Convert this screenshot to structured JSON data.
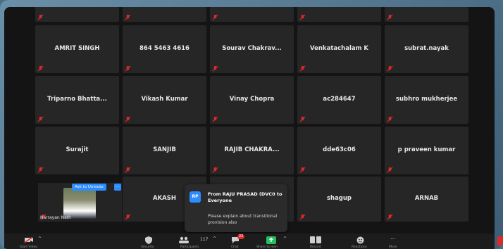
{
  "tiles": [
    {
      "name": "",
      "row": 0
    },
    {
      "name": "AMRIT SINGH",
      "row": 1,
      "col": 0
    },
    {
      "name": "864 5463 4616",
      "row": 1,
      "col": 1
    },
    {
      "name": "Sourav  Chakrav...",
      "row": 1,
      "col": 2
    },
    {
      "name": "Venkatachalam K",
      "row": 1,
      "col": 3
    },
    {
      "name": "subrat.nayak",
      "row": 1,
      "col": 4
    },
    {
      "name": "Triparno  Bhatta...",
      "row": 2,
      "col": 0
    },
    {
      "name": "Vikash Kumar",
      "row": 2,
      "col": 1
    },
    {
      "name": "Vinay Chopra",
      "row": 2,
      "col": 2
    },
    {
      "name": "ac284647",
      "row": 2,
      "col": 3
    },
    {
      "name": "subhro mukherjee",
      "row": 2,
      "col": 4
    },
    {
      "name": "Surajit",
      "row": 3,
      "col": 0
    },
    {
      "name": "SANJIB",
      "row": 3,
      "col": 1
    },
    {
      "name": "RAJIB CHAKRA...",
      "row": 3,
      "col": 2
    },
    {
      "name": "dde63c06",
      "row": 3,
      "col": 3
    },
    {
      "name": "p praveen kumar",
      "row": 3,
      "col": 4
    },
    {
      "name": "AKASH",
      "row": 4,
      "col": 1
    },
    {
      "name": "shagup",
      "row": 4,
      "col": 3
    },
    {
      "name": "ARNAB",
      "row": 4,
      "col": 4
    }
  ],
  "self_video": {
    "name": "Narrayan Nath",
    "ask_unmute": "Ask to Unmute",
    "more": "..."
  },
  "chat_popup": {
    "avatar": "RP",
    "from": "From RAJU PRASAD (DVC0 to Everyone",
    "message": "Please explain about transitional provision also"
  },
  "toolbar": {
    "start_video": "Start Video",
    "security": "Security",
    "participants_count": "117",
    "participants": "Participants",
    "chat": "Chat",
    "chat_badge": "22",
    "share_screen": "Share Screen",
    "record": "Record",
    "reactions": "Reactions",
    "more": "More",
    "more_dots": "..."
  },
  "colors": {
    "tile_bg": "#262626",
    "accent": "#2d8cff",
    "muted_icon": "#e02828"
  }
}
